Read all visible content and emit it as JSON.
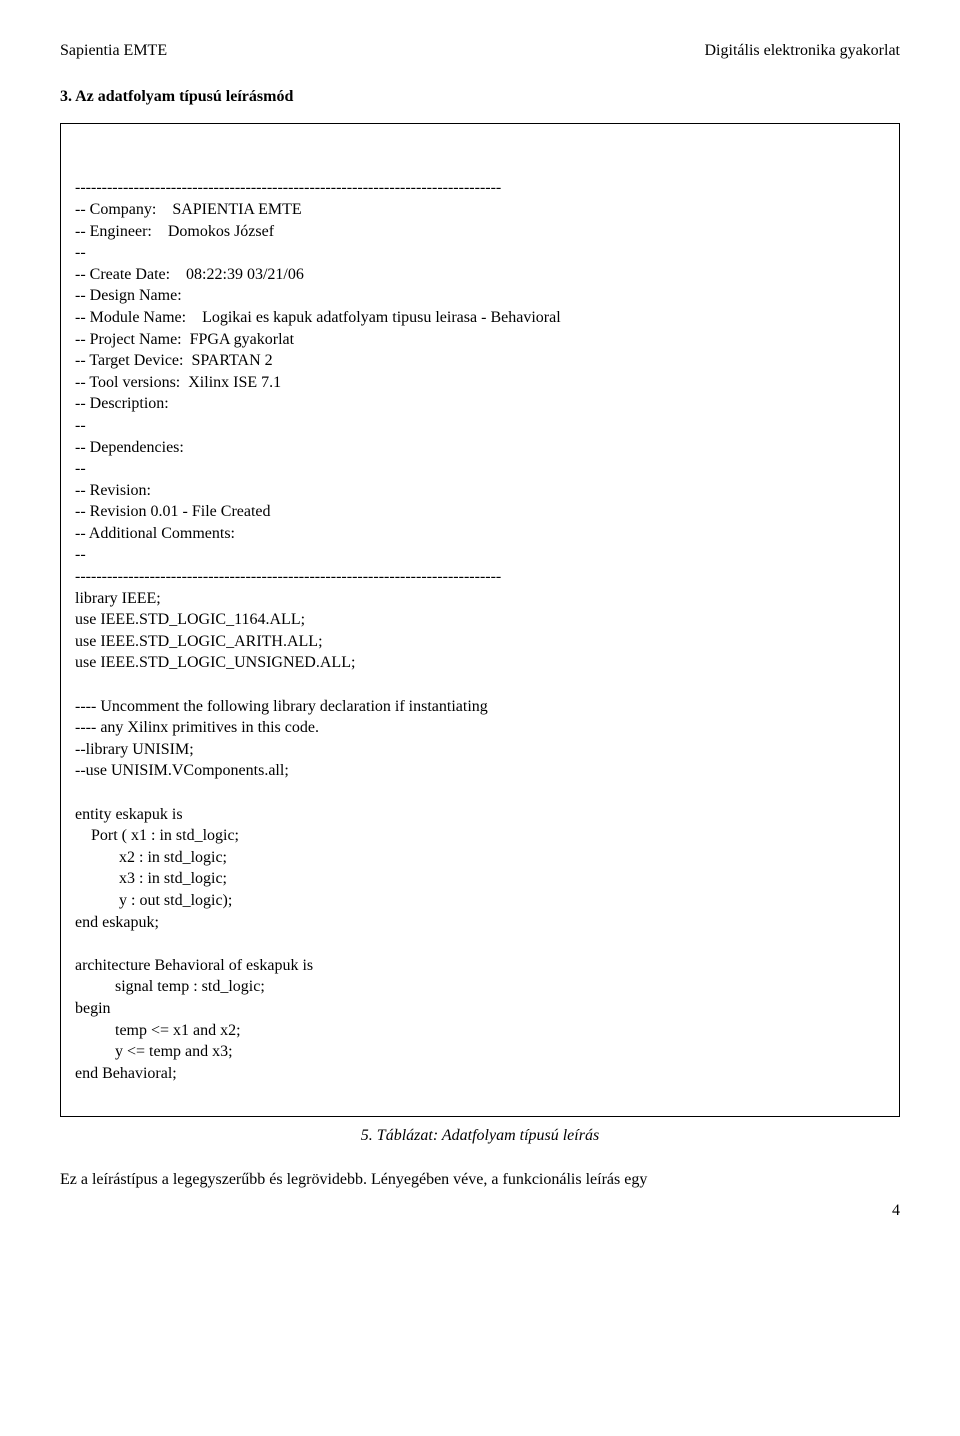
{
  "header": {
    "left": "Sapientia EMTE",
    "right": "Digitális elektronika gyakorlat"
  },
  "section_title": "3. Az adatfolyam típusú leírásmód",
  "code": {
    "lines": [
      "--------------------------------------------------------------------------------",
      "-- Company:    SAPIENTIA EMTE",
      "-- Engineer:    Domokos József",
      "--",
      "-- Create Date:    08:22:39 03/21/06",
      "-- Design Name:",
      "-- Module Name:    Logikai es kapuk adatfolyam tipusu leirasa - Behavioral",
      "-- Project Name:  FPGA gyakorlat",
      "-- Target Device:  SPARTAN 2",
      "-- Tool versions:  Xilinx ISE 7.1",
      "-- Description:",
      "--",
      "-- Dependencies:",
      "--",
      "-- Revision:",
      "-- Revision 0.01 - File Created",
      "-- Additional Comments:",
      "--",
      "--------------------------------------------------------------------------------",
      "library IEEE;",
      "use IEEE.STD_LOGIC_1164.ALL;",
      "use IEEE.STD_LOGIC_ARITH.ALL;",
      "use IEEE.STD_LOGIC_UNSIGNED.ALL;",
      "",
      "---- Uncomment the following library declaration if instantiating",
      "---- any Xilinx primitives in this code.",
      "--library UNISIM;",
      "--use UNISIM.VComponents.all;",
      "",
      "entity eskapuk is",
      "    Port ( x1 : in std_logic;",
      "           x2 : in std_logic;",
      "           x3 : in std_logic;",
      "           y : out std_logic);",
      "end eskapuk;",
      "",
      "architecture Behavioral of eskapuk is",
      "          signal temp : std_logic;",
      "begin",
      "          temp <= x1 and x2;",
      "          y <= temp and x3;",
      "end Behavioral;"
    ]
  },
  "caption": "5. Táblázat: Adatfolyam típusú leírás",
  "body_text": "Ez a leírástípus a legegyszerűbb és legrövidebb. Lényegében véve, a funkcionális leírás egy",
  "page_number": "4"
}
